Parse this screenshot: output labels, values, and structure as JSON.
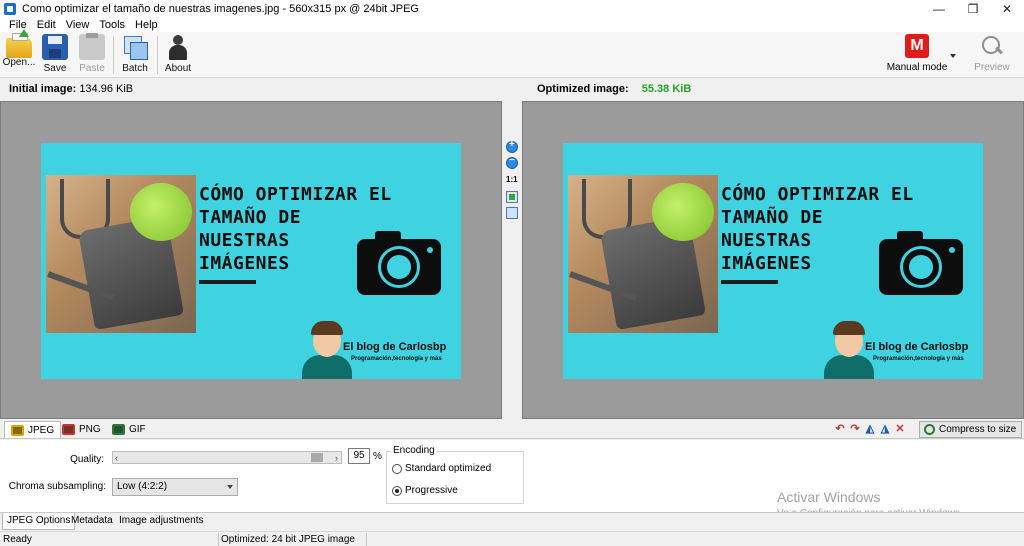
{
  "window": {
    "title": "Como optimizar el tamaño de nuestras imagenes.jpg - 560x315 px @ 24bit JPEG",
    "minimize": "—",
    "maximize": "❐",
    "close": "✕"
  },
  "menu": [
    "File",
    "Edit",
    "View",
    "Tools",
    "Help"
  ],
  "toolbar": {
    "open": "Open...",
    "save": "Save",
    "paste": "Paste",
    "batch": "Batch",
    "about": "About",
    "mode_badge": "M",
    "mode_label": "Manual mode",
    "preview": "Preview"
  },
  "info": {
    "initial_label": "Initial image:",
    "initial_size": "134.96 KiB",
    "optimized_label": "Optimized image:",
    "optimized_size": "55.38 KiB"
  },
  "image": {
    "headline_lines": [
      "CÓMO OPTIMIZAR EL",
      "TAMAÑO DE",
      "NUESTRAS",
      "IMÁGENES"
    ],
    "blog_title": "El blog de Carlosbp",
    "blog_subtitle": "Programación,tecnología y más"
  },
  "zoom": {
    "actual_size": "1:1"
  },
  "format_tabs": [
    "JPEG",
    "PNG",
    "GIF"
  ],
  "compress_to_size": "Compress to size",
  "options": {
    "quality_label": "Quality:",
    "quality_value": "95",
    "quality_fraction": 0.95,
    "percent": "%",
    "chroma_label": "Chroma subsampling:",
    "chroma_value": "Low (4:2:2)",
    "encoding_label": "Encoding",
    "encoding_options": [
      "Standard optimized",
      "Progressive"
    ],
    "encoding_selected": "Progressive"
  },
  "bottom_tabs": [
    "JPEG Options",
    "Metadata",
    "Image adjustments"
  ],
  "status": {
    "left": "Ready",
    "middle": "Optimized: 24 bit JPEG image"
  },
  "watermark": {
    "title": "Activar Windows",
    "subtitle": "Ve a Configuración para activar Windows."
  }
}
